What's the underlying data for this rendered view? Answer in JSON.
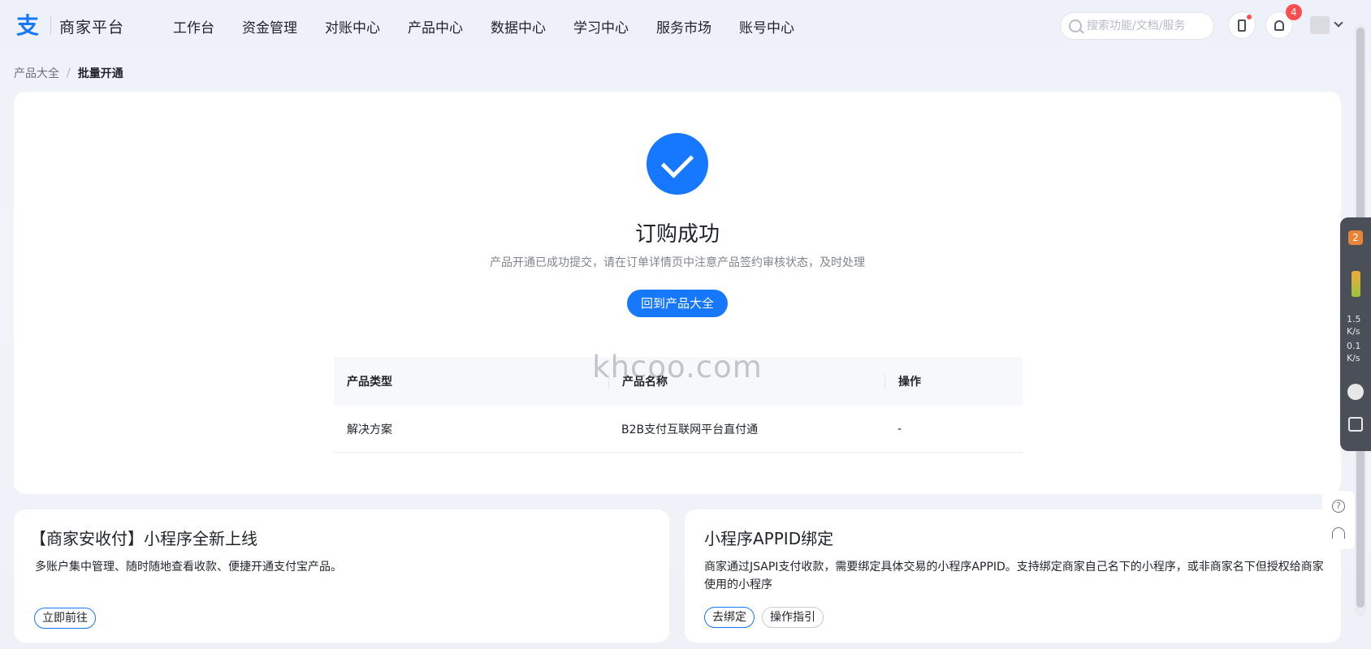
{
  "header": {
    "logo_mark": "支",
    "logo_text": "商家平台",
    "nav": [
      "工作台",
      "资金管理",
      "对账中心",
      "产品中心",
      "数据中心",
      "学习中心",
      "服务市场",
      "账号中心"
    ],
    "search_placeholder": "搜索功能/文档/服务",
    "notification_count": "4"
  },
  "breadcrumb": {
    "parent": "产品大全",
    "separator": "/",
    "current": "批量开通"
  },
  "result": {
    "title": "订购成功",
    "description": "产品开通已成功提交，请在订单详情页中注意产品签约审核状态，及时处理",
    "button_label": "回到产品大全"
  },
  "table": {
    "headers": [
      "产品类型",
      "产品名称",
      "操作"
    ],
    "rows": [
      [
        "解决方案",
        "B2B支付互联网平台直付通",
        "-"
      ]
    ]
  },
  "watermark": "khcoo.com",
  "cards": [
    {
      "title": "【商家安收付】小程序全新上线",
      "description": "多账户集中管理、随时随地查看收款、便捷开通支付宝产品。",
      "buttons": [
        "立即前往"
      ]
    },
    {
      "title": "小程序APPID绑定",
      "description": "商家通过JSAPI支付收款，需要绑定具体交易的小程序APPID。支持绑定商家自己名下的小程序，或非商家名下但授权给商家使用的小程序",
      "buttons": [
        "去绑定",
        "操作指引"
      ]
    }
  ],
  "float_panel": {
    "badge": "2",
    "up_value": "1.5",
    "up_unit": "K/s",
    "down_value": "0.1",
    "down_unit": "K/s"
  },
  "colors": {
    "primary": "#1677ff",
    "alert": "#ff4d4f"
  }
}
